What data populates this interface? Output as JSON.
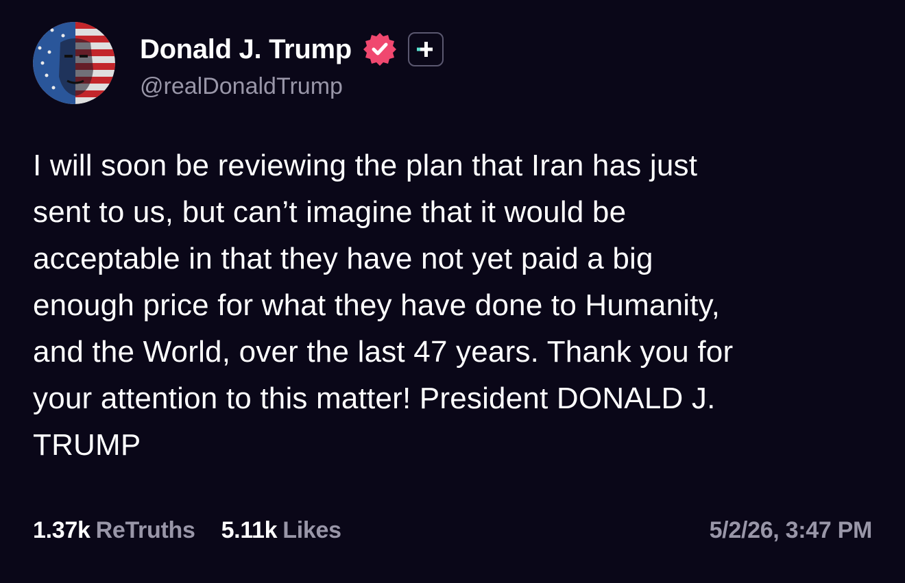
{
  "post": {
    "author": {
      "display_name": "Donald J. Trump",
      "handle": "@realDonaldTrump",
      "verified_icon": "verified-badge-icon",
      "plus_icon": "truth-plus-icon",
      "avatar_icon": "avatar-flag-portrait"
    },
    "body_lines": [
      "I will soon be reviewing the plan that Iran has just",
      "sent to us, but can’t imagine that it would be",
      "acceptable in that they have not yet paid a big",
      "enough price for what they have done to Humanity,",
      "and the World, over the last 47 years. Thank you for",
      "your attention to this matter! President DONALD J.",
      "TRUMP"
    ],
    "stats": {
      "retruths_count": "1.37k",
      "retruths_label": "ReTruths",
      "likes_count": "5.11k",
      "likes_label": "Likes"
    },
    "timestamp": "5/2/26, 3:47 PM"
  },
  "colors": {
    "background": "#0a0718",
    "text_primary": "#ffffff",
    "text_secondary": "#9996a8",
    "verified_badge": "#f0486f",
    "plus_accent": "#5be2d0"
  }
}
